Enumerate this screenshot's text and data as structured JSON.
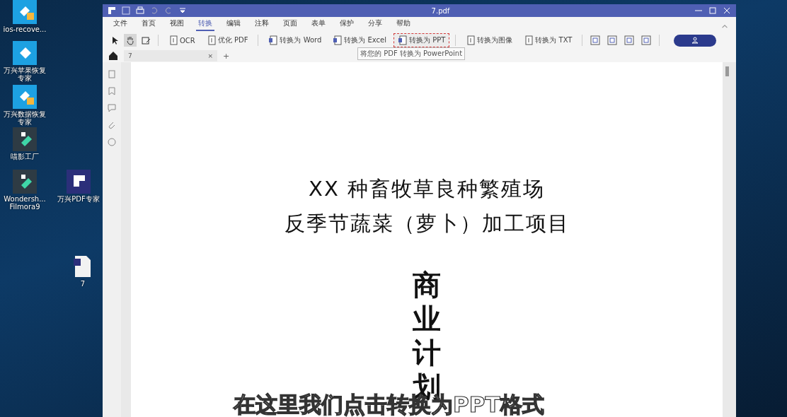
{
  "desktop_icons": [
    {
      "label": "ios-recove...",
      "kind": "recovery"
    },
    {
      "label": "万兴苹果恢复专家",
      "kind": "apple"
    },
    {
      "label": "万兴数据恢复专家",
      "kind": "recovery"
    },
    {
      "label": "喵影工厂",
      "kind": "filmora"
    },
    {
      "label": "Wondersh... Filmora9",
      "kind": "filmora"
    },
    {
      "label": "万兴PDF专家",
      "kind": "pdf"
    },
    {
      "label": "7",
      "kind": "file"
    }
  ],
  "window": {
    "title": "7.pdf"
  },
  "menu": [
    {
      "label": "文件",
      "selected": false
    },
    {
      "label": "首页",
      "selected": false
    },
    {
      "label": "视图",
      "selected": false
    },
    {
      "label": "转换",
      "selected": true
    },
    {
      "label": "编辑",
      "selected": false
    },
    {
      "label": "注释",
      "selected": false
    },
    {
      "label": "页面",
      "selected": false
    },
    {
      "label": "表单",
      "selected": false
    },
    {
      "label": "保护",
      "selected": false
    },
    {
      "label": "分享",
      "selected": false
    },
    {
      "label": "帮助",
      "selected": false
    }
  ],
  "tools": [
    {
      "kind": "select",
      "selected": false
    },
    {
      "kind": "hand",
      "selected": true
    },
    {
      "kind": "edit",
      "selected": false
    }
  ],
  "toolbar": [
    {
      "label": "OCR",
      "highlighted": false
    },
    {
      "label": "优化 PDF",
      "highlighted": false
    },
    {
      "label": "转换为 Word",
      "highlighted": false
    },
    {
      "label": "转换为 Excel",
      "highlighted": false
    },
    {
      "label": "转换为 PPT",
      "highlighted": true
    },
    {
      "label": "转换为图像",
      "highlighted": false
    },
    {
      "label": "转换为 TXT",
      "highlighted": false
    }
  ],
  "tooltip": "将您的 PDF 转换为 PowerPoint",
  "doc_tab": {
    "label": "7",
    "close": "×",
    "add": "+"
  },
  "document": {
    "title_lines": [
      "XX 种畜牧草良种繁殖场",
      "反季节蔬菜（萝卜）加工项目"
    ],
    "vertical_title": "商业计划"
  },
  "caption": "在这里我们点击转换为PPT格式"
}
